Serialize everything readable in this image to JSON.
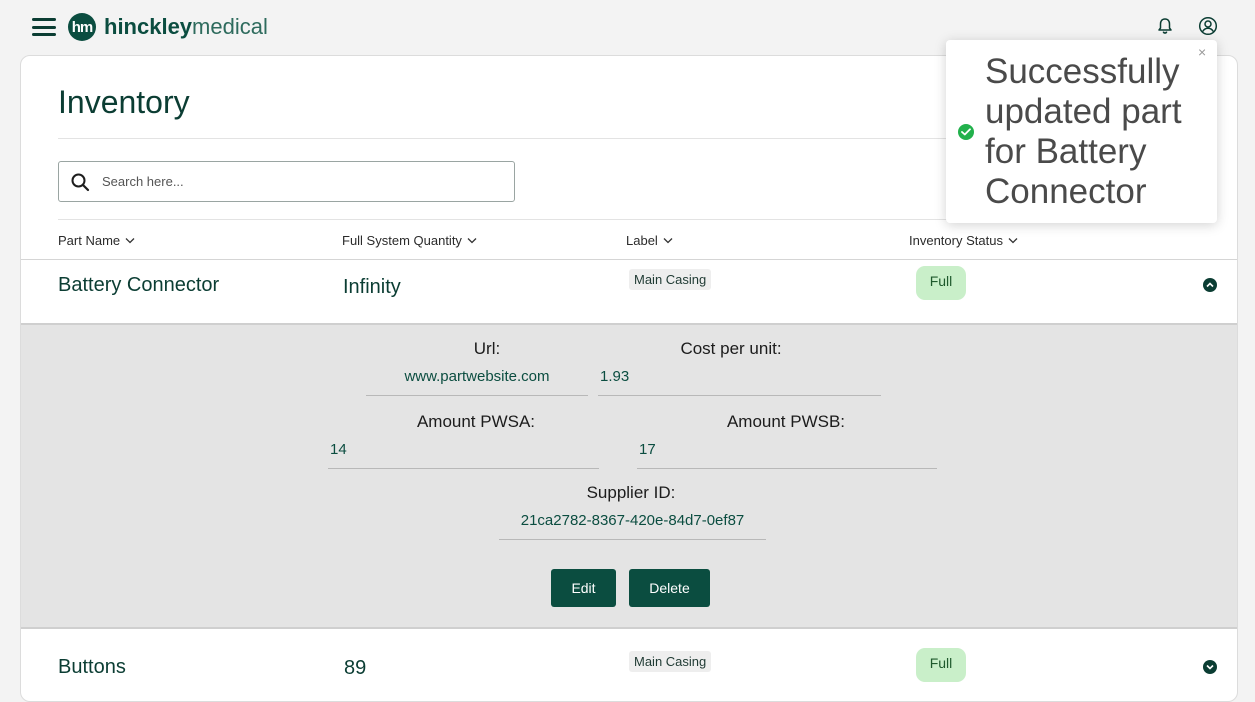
{
  "app": {
    "logo_mark": "hm",
    "logo_bold": "hinckley",
    "logo_light": "medical",
    "icons": [
      "menu-icon",
      "bell-icon",
      "user-circle-icon"
    ]
  },
  "page": {
    "title": "Inventory",
    "search_placeholder": "Search here..."
  },
  "table": {
    "columns": [
      "Part Name",
      "Full System Quantity",
      "Label",
      "Inventory Status"
    ],
    "rows": [
      {
        "name": "Battery Connector",
        "quantity": "Infinity",
        "label": "Main Casing",
        "status": "Full",
        "expanded": true
      },
      {
        "name": "Buttons",
        "quantity": "89",
        "label": "Main Casing",
        "status": "Full",
        "expanded": false
      }
    ]
  },
  "details": {
    "url_label": "Url:",
    "url_value": "www.partwebsite.com",
    "cost_label": "Cost per unit:",
    "cost_value": "1.93",
    "pwsa_label": "Amount PWSA:",
    "pwsa_value": "14",
    "pwsb_label": "Amount PWSB:",
    "pwsb_value": "17",
    "supplier_label": "Supplier ID:",
    "supplier_value": "21ca2782-8367-420e-84d7-0ef87",
    "edit_label": "Edit",
    "delete_label": "Delete"
  },
  "toast": {
    "message": "Successfully updated part for Battery Connector",
    "close": "×",
    "color": "#22b14c"
  },
  "colors": {
    "brand": "#0b4d40",
    "status_full_bg": "#c9efc9",
    "details_bg": "#e4e4e4"
  }
}
